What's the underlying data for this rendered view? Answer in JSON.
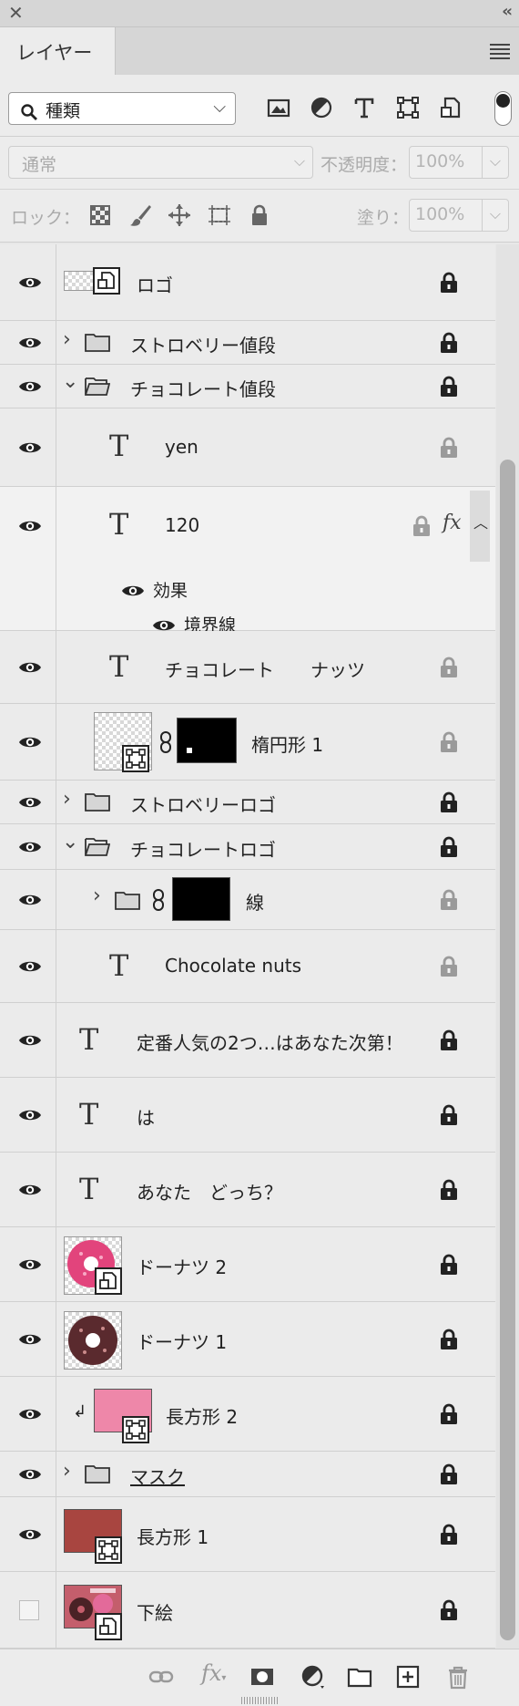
{
  "window": {
    "close_glyph": "✕",
    "collapse_glyph": "‹‹"
  },
  "tab": {
    "label": "レイヤー"
  },
  "filter": {
    "kind_value": "種類",
    "icons": [
      "image-filter-icon",
      "adjustment-filter-icon",
      "type-filter-icon",
      "shape-filter-icon",
      "smart-object-filter-icon"
    ]
  },
  "blend": {
    "mode_value": "通常",
    "opacity_label": "不透明度：",
    "opacity_value": "100%"
  },
  "lock": {
    "label": "ロック：",
    "fill_label": "塗り：",
    "fill_value": "100%"
  },
  "layers": [
    {
      "name": "ロゴ"
    },
    {
      "name": "ストロベリー値段"
    },
    {
      "name": "チョコレート値段"
    },
    {
      "name": "yen"
    },
    {
      "name": "120",
      "effects_label": "効果",
      "effect_item": "境界線"
    },
    {
      "name": "チョコレート　　ナッツ"
    },
    {
      "name": "楕円形 1"
    },
    {
      "name": "ストロベリーロゴ"
    },
    {
      "name": "チョコレートロゴ"
    },
    {
      "name": "線"
    },
    {
      "name": "Chocolate nuts"
    },
    {
      "name": "定番人気の2つ…はあなた次第！"
    },
    {
      "name": "は"
    },
    {
      "name": "あなた　どっち？"
    },
    {
      "name": "ドーナツ 2"
    },
    {
      "name": "ドーナツ 1"
    },
    {
      "name": "長方形 2"
    },
    {
      "name": "マスク"
    },
    {
      "name": "長方形 1"
    },
    {
      "name": "下絵"
    }
  ],
  "colors": {
    "pink_rect": "#ee87a9",
    "brown_rect": "#a84540",
    "black_mask": "#000000"
  }
}
